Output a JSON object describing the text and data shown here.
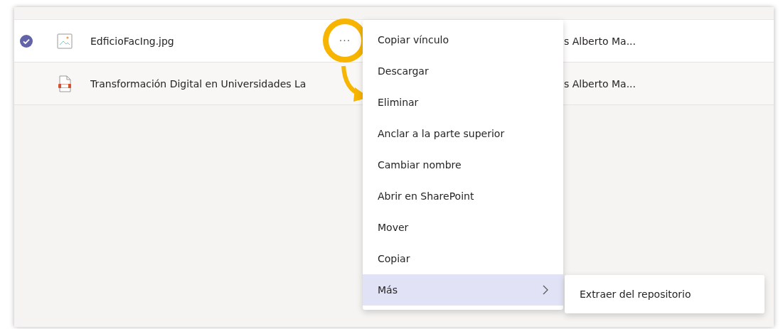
{
  "files": [
    {
      "name": "EdficioFacIng.jpg",
      "owner": "s Alberto Ma...",
      "kind": "image",
      "selected": true,
      "more": "···"
    },
    {
      "name": "Transformación Digital en Universidades La",
      "owner": "s Alberto Ma...",
      "kind": "presentation",
      "selected": false
    }
  ],
  "menu": {
    "items": [
      {
        "label": "Copiar vínculo",
        "selected": false,
        "kind": "action"
      },
      {
        "label": "Descargar",
        "selected": false,
        "kind": "action"
      },
      {
        "label": "Eliminar",
        "selected": false,
        "kind": "action"
      },
      {
        "label": "Anclar a la parte superior",
        "selected": false,
        "kind": "action"
      },
      {
        "label": "Cambiar nombre",
        "selected": false,
        "kind": "action"
      },
      {
        "label": "Abrir en SharePoint",
        "selected": false,
        "kind": "action"
      },
      {
        "label": "Mover",
        "selected": false,
        "kind": "action"
      },
      {
        "label": "Copiar",
        "selected": false,
        "kind": "action"
      },
      {
        "label": "Más",
        "selected": true,
        "kind": "submenu"
      }
    ],
    "submenu": [
      "Extraer del repositorio"
    ]
  }
}
